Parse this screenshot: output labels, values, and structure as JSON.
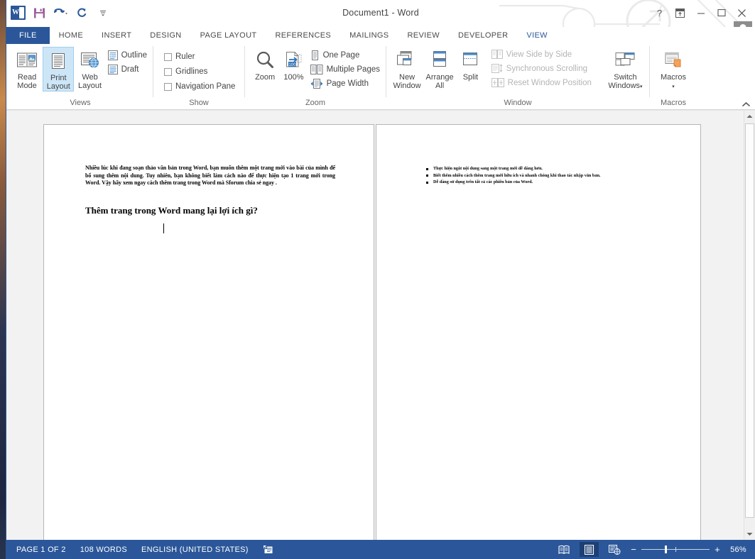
{
  "window": {
    "title": "Document1 - Word",
    "quick_access": [
      {
        "name": "word-logo",
        "label": "W"
      },
      {
        "name": "save-icon",
        "label": "Save"
      },
      {
        "name": "undo-icon",
        "label": "Undo"
      },
      {
        "name": "redo-icon",
        "label": "Redo"
      },
      {
        "name": "customize-qat-icon",
        "label": "Customize Quick Access Toolbar"
      }
    ],
    "controls": {
      "help": "?",
      "ribbon_display": "Ribbon Display Options",
      "minimize": "Minimize",
      "restore": "Restore Down",
      "close": "Close"
    },
    "account_caret": "▾"
  },
  "tabs": [
    {
      "label": "FILE",
      "active": false,
      "file": true
    },
    {
      "label": "HOME",
      "active": false
    },
    {
      "label": "INSERT",
      "active": false
    },
    {
      "label": "DESIGN",
      "active": false
    },
    {
      "label": "PAGE LAYOUT",
      "active": false
    },
    {
      "label": "REFERENCES",
      "active": false
    },
    {
      "label": "MAILINGS",
      "active": false
    },
    {
      "label": "REVIEW",
      "active": false
    },
    {
      "label": "DEVELOPER",
      "active": false
    },
    {
      "label": "VIEW",
      "active": true
    }
  ],
  "ribbon": {
    "collapse_label": "^",
    "groups": {
      "views": {
        "title": "Views",
        "buttons": [
          {
            "label_line1": "Read",
            "label_line2": "Mode",
            "icon": "read-mode-icon",
            "selected": false
          },
          {
            "label_line1": "Print",
            "label_line2": "Layout",
            "icon": "print-layout-icon",
            "selected": true
          },
          {
            "label_line1": "Web",
            "label_line2": "Layout",
            "icon": "web-layout-icon",
            "selected": false
          }
        ],
        "small": [
          {
            "label": "Outline",
            "icon": "outline-icon"
          },
          {
            "label": "Draft",
            "icon": "draft-icon"
          }
        ]
      },
      "show": {
        "title": "Show",
        "checkboxes": [
          {
            "label": "Ruler",
            "checked": false
          },
          {
            "label": "Gridlines",
            "checked": false
          },
          {
            "label": "Navigation Pane",
            "checked": false
          }
        ]
      },
      "zoom": {
        "title": "Zoom",
        "buttons": [
          {
            "label_line1": "Zoom",
            "label_line2": "",
            "icon": "magnifier-icon"
          },
          {
            "label_line1": "100%",
            "label_line2": "",
            "icon": "zoom-100-icon"
          }
        ],
        "small": [
          {
            "label": "One Page",
            "icon": "one-page-icon"
          },
          {
            "label": "Multiple Pages",
            "icon": "multiple-pages-icon"
          },
          {
            "label": "Page Width",
            "icon": "page-width-icon"
          }
        ]
      },
      "window": {
        "title": "Window",
        "buttons": [
          {
            "label_line1": "New",
            "label_line2": "Window",
            "icon": "new-window-icon"
          },
          {
            "label_line1": "Arrange",
            "label_line2": "All",
            "icon": "arrange-all-icon"
          },
          {
            "label_line1": "Split",
            "label_line2": "",
            "icon": "split-icon"
          }
        ],
        "small": [
          {
            "label": "View Side by Side",
            "icon": "view-side-by-side-icon",
            "disabled": true
          },
          {
            "label": "Synchronous Scrolling",
            "icon": "synchronous-scrolling-icon",
            "disabled": true
          },
          {
            "label": "Reset Window Position",
            "icon": "reset-window-position-icon",
            "disabled": true
          }
        ],
        "switch_windows": {
          "label_line1": "Switch",
          "label_line2": "Windows",
          "caret": "▾",
          "icon": "switch-windows-icon"
        }
      },
      "macros": {
        "title": "Macros",
        "button": {
          "label_line1": "Macros",
          "label_line2": "",
          "caret": "▾",
          "icon": "macros-icon"
        }
      }
    }
  },
  "document": {
    "page1": {
      "body": "Nhiều lúc khi đang soạn thảo văn bản trong Word, bạn muốn thêm một trang mới vào bài của mình để bổ sung thêm nội dung. Tuy nhiên, bạn không biết làm cách nào để thực hiện tạo 1 trang mới trong Word. Vậy hãy xem ngay cách thêm trang trong Word mà Sforum chia sẻ ngay .",
      "heading": "Thêm trang trong Word mang lại lợi ích gì?"
    },
    "page2": {
      "bullets": [
        "Thực hiện ngắt nội dung sang một trang mới dễ dàng hơn.",
        "Biết thêm nhiều cách thêm trang mới hữu ích và nhanh chóng khi thao tác nhập văn bản.",
        "Dễ dàng sử dụng trên tất cả các phiên bản của Word."
      ]
    }
  },
  "statusbar": {
    "page": "PAGE 1 OF 2",
    "words": "108 WORDS",
    "language": "ENGLISH (UNITED STATES)",
    "proofing_icon": "proofing-errors-icon",
    "views": [
      {
        "name": "read-mode-view-icon",
        "active": false
      },
      {
        "name": "print-layout-view-icon",
        "active": true
      },
      {
        "name": "web-layout-view-icon",
        "active": false
      }
    ],
    "zoom_out": "−",
    "zoom_in": "+",
    "zoom_level": "56%"
  }
}
